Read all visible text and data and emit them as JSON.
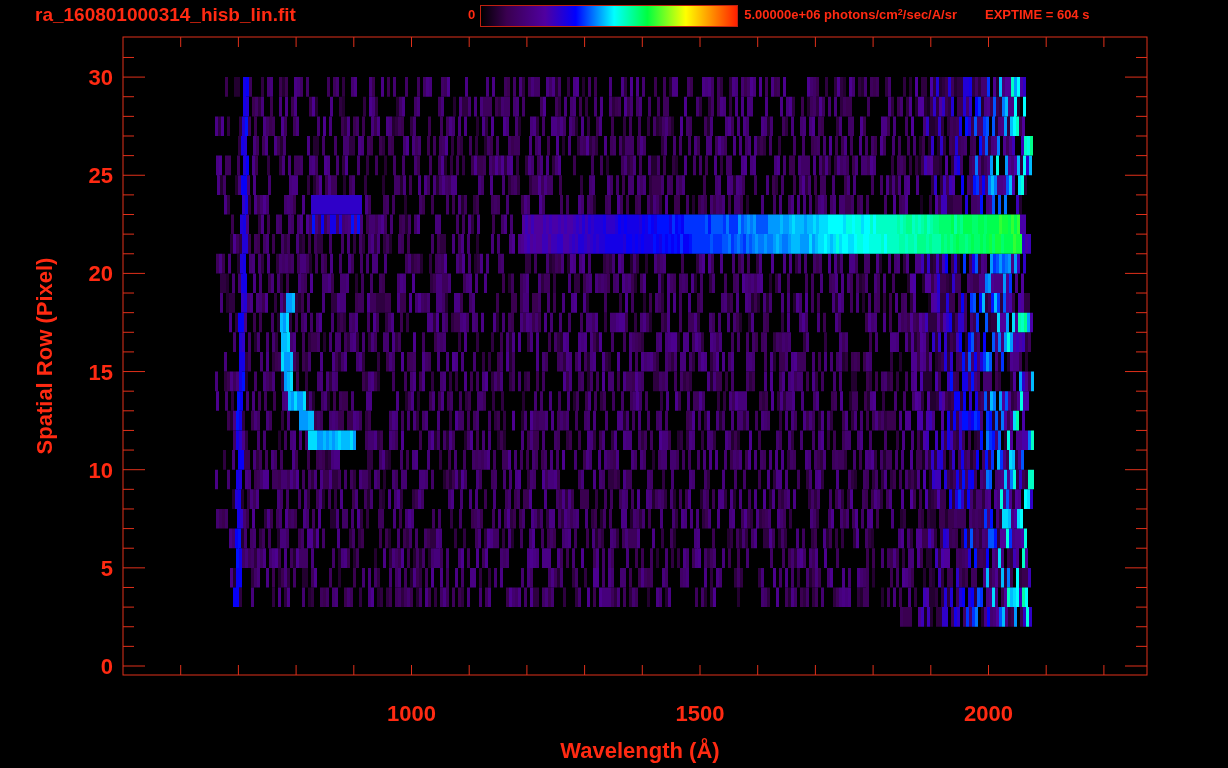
{
  "title": "ra_160801000314_hisb_lin.fit",
  "colorbar": {
    "min_label": "0",
    "max_label": "5.00000e+06 photons/cm$^{2}$/sec/A/sr"
  },
  "exptime": "EXPTIME = 604 s",
  "x_axis": {
    "label": "Wavelength (Å)",
    "tick_labels": [
      "1000",
      "1500",
      "2000"
    ]
  },
  "y_axis": {
    "label": "Spatial Row (Pixel)",
    "tick_labels": [
      "30",
      "25",
      "20",
      "15",
      "10",
      "5",
      "0"
    ]
  }
}
